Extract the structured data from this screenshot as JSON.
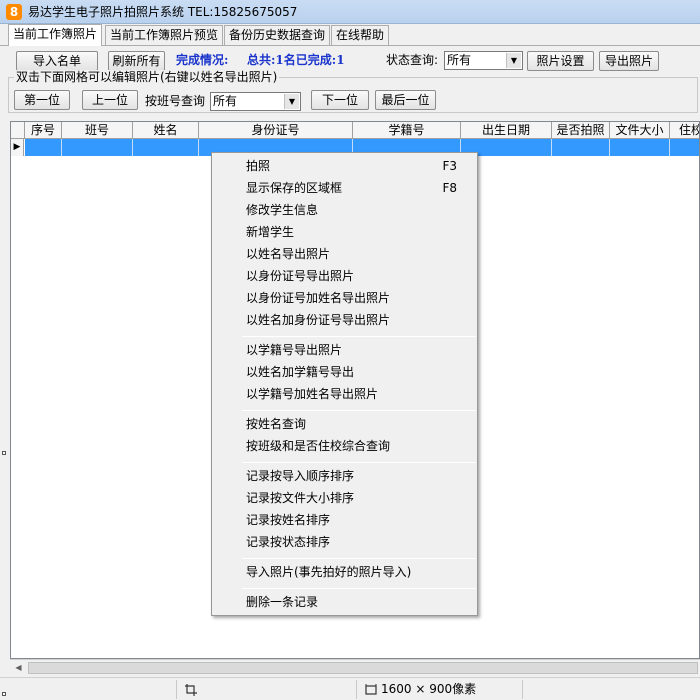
{
  "window": {
    "title": "易达学生电子照片拍照片系统 TEL:15825675057",
    "icon_char": "8"
  },
  "tabs": [
    {
      "label": "当前工作簿照片"
    },
    {
      "label": "当前工作簿照片预览"
    },
    {
      "label": "备份历史数据查询"
    },
    {
      "label": "在线帮助"
    }
  ],
  "toolbar": {
    "import_label": "导入名单",
    "refresh_label": "刷新所有",
    "completion_label": "完成情况:",
    "completion_value": "总共:1名已完成:1",
    "status_query_label": "状态查询:",
    "status_value": "所有",
    "photo_settings_label": "照片设置",
    "export_photos_label": "导出照片"
  },
  "group": {
    "label": "双击下面网格可以编辑照片(右键以姓名导出照片)"
  },
  "nav": {
    "first_label": "第一位",
    "prev_label": "上一位",
    "class_query_label": "按班号查询",
    "class_value": "所有",
    "next_label": "下一位",
    "last_label": "最后一位"
  },
  "grid": {
    "columns": [
      "序号",
      "班号",
      "姓名",
      "身份证号",
      "学籍号",
      "出生日期",
      "是否拍照",
      "文件大小",
      "住校"
    ],
    "row_indicator": "▶"
  },
  "context_menu": {
    "groups": [
      [
        {
          "label": "拍照",
          "shortcut": "F3"
        },
        {
          "label": "显示保存的区域框",
          "shortcut": "F8"
        },
        {
          "label": "修改学生信息",
          "shortcut": ""
        },
        {
          "label": "新增学生",
          "shortcut": ""
        },
        {
          "label": "以姓名导出照片",
          "shortcut": ""
        },
        {
          "label": "以身份证号导出照片",
          "shortcut": ""
        },
        {
          "label": "以身份证号加姓名导出照片",
          "shortcut": ""
        },
        {
          "label": "以姓名加身份证号导出照片",
          "shortcut": ""
        }
      ],
      [
        {
          "label": "以学籍号导出照片",
          "shortcut": ""
        },
        {
          "label": "以姓名加学籍号导出",
          "shortcut": ""
        },
        {
          "label": "以学籍号加姓名导出照片",
          "shortcut": ""
        }
      ],
      [
        {
          "label": "按姓名查询",
          "shortcut": ""
        },
        {
          "label": "按班级和是否住校综合查询",
          "shortcut": ""
        }
      ],
      [
        {
          "label": "记录按导入顺序排序",
          "shortcut": ""
        },
        {
          "label": "记录按文件大小排序",
          "shortcut": ""
        },
        {
          "label": "记录按姓名排序",
          "shortcut": ""
        },
        {
          "label": "记录按状态排序",
          "shortcut": ""
        }
      ],
      [
        {
          "label": "导入照片(事先拍好的照片导入)",
          "shortcut": ""
        }
      ],
      [
        {
          "label": "删除一条记录",
          "shortcut": ""
        }
      ]
    ]
  },
  "statusbar": {
    "resolution": "1600 × 900像素"
  },
  "colors": {
    "selection": "#3399ff",
    "completion_text": "#1a34cc",
    "titlebar": "#c9dcf3"
  },
  "icons": {
    "dropdown": "chevron-down-icon",
    "row_indicator": "row-pointer-icon",
    "crop": "crop-icon",
    "dimensions": "dimensions-icon"
  }
}
